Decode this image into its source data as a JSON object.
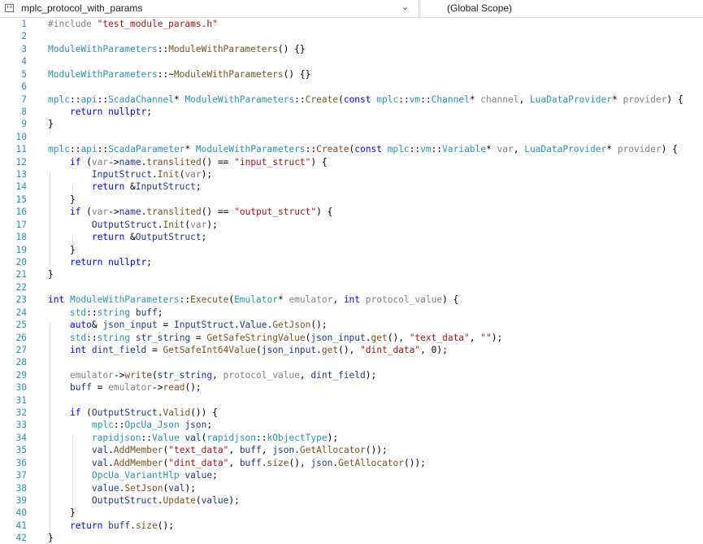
{
  "nav": {
    "project_name": "mplc_protocol_with_params",
    "scope_name": "(Global Scope)"
  },
  "editor": {
    "lines": [
      {
        "n": "1",
        "t": [
          [
            "pp",
            "#include "
          ],
          [
            "st",
            "\"test_module_params.h\""
          ]
        ]
      },
      {
        "n": "2",
        "t": []
      },
      {
        "n": "3",
        "t": [
          [
            "ty",
            "ModuleWithParameters"
          ],
          [
            "pu",
            "::"
          ],
          [
            "fn",
            "ModuleWithParameters"
          ],
          [
            "pu",
            "() {}"
          ]
        ]
      },
      {
        "n": "4",
        "t": []
      },
      {
        "n": "5",
        "t": [
          [
            "ty",
            "ModuleWithParameters"
          ],
          [
            "pu",
            "::~"
          ],
          [
            "fn",
            "ModuleWithParameters"
          ],
          [
            "pu",
            "() {}"
          ]
        ]
      },
      {
        "n": "6",
        "t": []
      },
      {
        "n": "7",
        "t": [
          [
            "ns",
            "mplc"
          ],
          [
            "pu",
            "::"
          ],
          [
            "ns",
            "api"
          ],
          [
            "pu",
            "::"
          ],
          [
            "ty",
            "ScadaChannel"
          ],
          [
            "pu",
            "* "
          ],
          [
            "ty",
            "ModuleWithParameters"
          ],
          [
            "pu",
            "::"
          ],
          [
            "fn",
            "Create"
          ],
          [
            "pu",
            "("
          ],
          [
            "kw",
            "const "
          ],
          [
            "ns",
            "mplc"
          ],
          [
            "pu",
            "::"
          ],
          [
            "ns",
            "vm"
          ],
          [
            "pu",
            "::"
          ],
          [
            "ty",
            "Channel"
          ],
          [
            "pu",
            "* "
          ],
          [
            "pm",
            "channel"
          ],
          [
            "pu",
            ", "
          ],
          [
            "ty",
            "LuaDataProvider"
          ],
          [
            "pu",
            "* "
          ],
          [
            "pm",
            "provider"
          ],
          [
            "pu",
            ") {"
          ]
        ]
      },
      {
        "n": "8",
        "t": [
          [
            "pu",
            "    "
          ],
          [
            "kw",
            "return "
          ],
          [
            "kw",
            "nullptr"
          ],
          [
            "pu",
            ";"
          ]
        ]
      },
      {
        "n": "9",
        "t": [
          [
            "pu",
            "}"
          ]
        ]
      },
      {
        "n": "10",
        "t": []
      },
      {
        "n": "11",
        "t": [
          [
            "ns",
            "mplc"
          ],
          [
            "pu",
            "::"
          ],
          [
            "ns",
            "api"
          ],
          [
            "pu",
            "::"
          ],
          [
            "ty",
            "ScadaParameter"
          ],
          [
            "pu",
            "* "
          ],
          [
            "ty",
            "ModuleWithParameters"
          ],
          [
            "pu",
            "::"
          ],
          [
            "fn",
            "Create"
          ],
          [
            "pu",
            "("
          ],
          [
            "kw",
            "const "
          ],
          [
            "ns",
            "mplc"
          ],
          [
            "pu",
            "::"
          ],
          [
            "ns",
            "vm"
          ],
          [
            "pu",
            "::"
          ],
          [
            "ty",
            "Variable"
          ],
          [
            "pu",
            "* "
          ],
          [
            "pm",
            "var"
          ],
          [
            "pu",
            ", "
          ],
          [
            "ty",
            "LuaDataProvider"
          ],
          [
            "pu",
            "* "
          ],
          [
            "pm",
            "provider"
          ],
          [
            "pu",
            ") {"
          ]
        ]
      },
      {
        "n": "12",
        "t": [
          [
            "pu",
            "    "
          ],
          [
            "kw",
            "if "
          ],
          [
            "pu",
            "("
          ],
          [
            "pm",
            "var"
          ],
          [
            "pu",
            "->"
          ],
          [
            "mv",
            "name"
          ],
          [
            "pu",
            "."
          ],
          [
            "fn",
            "translited"
          ],
          [
            "pu",
            "() == "
          ],
          [
            "st",
            "\"input_struct\""
          ],
          [
            "pu",
            ") {"
          ]
        ]
      },
      {
        "n": "13",
        "t": [
          [
            "pu",
            "        "
          ],
          [
            "ve",
            "InputStruct"
          ],
          [
            "pu",
            "."
          ],
          [
            "fn",
            "Init"
          ],
          [
            "pu",
            "("
          ],
          [
            "pm",
            "var"
          ],
          [
            "pu",
            ");"
          ]
        ]
      },
      {
        "n": "14",
        "t": [
          [
            "pu",
            "        "
          ],
          [
            "kw",
            "return "
          ],
          [
            "pu",
            "&"
          ],
          [
            "ve",
            "InputStruct"
          ],
          [
            "pu",
            ";"
          ]
        ]
      },
      {
        "n": "15",
        "t": [
          [
            "pu",
            "    }"
          ]
        ]
      },
      {
        "n": "16",
        "t": [
          [
            "pu",
            "    "
          ],
          [
            "kw",
            "if "
          ],
          [
            "pu",
            "("
          ],
          [
            "pm",
            "var"
          ],
          [
            "pu",
            "->"
          ],
          [
            "mv",
            "name"
          ],
          [
            "pu",
            "."
          ],
          [
            "fn",
            "translited"
          ],
          [
            "pu",
            "() == "
          ],
          [
            "st",
            "\"output_struct\""
          ],
          [
            "pu",
            ") {"
          ]
        ]
      },
      {
        "n": "17",
        "t": [
          [
            "pu",
            "        "
          ],
          [
            "ve",
            "OutputStruct"
          ],
          [
            "pu",
            "."
          ],
          [
            "fn",
            "Init"
          ],
          [
            "pu",
            "("
          ],
          [
            "pm",
            "var"
          ],
          [
            "pu",
            ");"
          ]
        ]
      },
      {
        "n": "18",
        "t": [
          [
            "pu",
            "        "
          ],
          [
            "kw",
            "return "
          ],
          [
            "pu",
            "&"
          ],
          [
            "ve",
            "OutputStruct"
          ],
          [
            "pu",
            ";"
          ]
        ]
      },
      {
        "n": "19",
        "t": [
          [
            "pu",
            "    }"
          ]
        ]
      },
      {
        "n": "20",
        "t": [
          [
            "pu",
            "    "
          ],
          [
            "kw",
            "return "
          ],
          [
            "kw",
            "nullptr"
          ],
          [
            "pu",
            ";"
          ]
        ]
      },
      {
        "n": "21",
        "t": [
          [
            "pu",
            "}"
          ]
        ]
      },
      {
        "n": "22",
        "t": []
      },
      {
        "n": "23",
        "t": [
          [
            "kw",
            "int "
          ],
          [
            "ty",
            "ModuleWithParameters"
          ],
          [
            "pu",
            "::"
          ],
          [
            "fn",
            "Execute"
          ],
          [
            "pu",
            "("
          ],
          [
            "ty",
            "Emulator"
          ],
          [
            "pu",
            "* "
          ],
          [
            "pm",
            "emulator"
          ],
          [
            "pu",
            ", "
          ],
          [
            "kw",
            "int "
          ],
          [
            "pm",
            "protocol_value"
          ],
          [
            "pu",
            ") {"
          ]
        ]
      },
      {
        "n": "24",
        "t": [
          [
            "pu",
            "    "
          ],
          [
            "ns",
            "std"
          ],
          [
            "pu",
            "::"
          ],
          [
            "ty",
            "string"
          ],
          [
            "pu",
            " "
          ],
          [
            "lv",
            "buff"
          ],
          [
            "pu",
            ";"
          ]
        ]
      },
      {
        "n": "25",
        "t": [
          [
            "pu",
            "    "
          ],
          [
            "kw",
            "auto"
          ],
          [
            "pu",
            "& "
          ],
          [
            "lv",
            "json_input"
          ],
          [
            "pu",
            " = "
          ],
          [
            "ve",
            "InputStruct"
          ],
          [
            "pu",
            "."
          ],
          [
            "mv",
            "Value"
          ],
          [
            "pu",
            "."
          ],
          [
            "fn",
            "GetJson"
          ],
          [
            "pu",
            "();"
          ]
        ]
      },
      {
        "n": "26",
        "t": [
          [
            "pu",
            "    "
          ],
          [
            "ns",
            "std"
          ],
          [
            "pu",
            "::"
          ],
          [
            "ty",
            "string"
          ],
          [
            "pu",
            " "
          ],
          [
            "lv",
            "str_string"
          ],
          [
            "pu",
            " = "
          ],
          [
            "fn",
            "GetSafeStringValue"
          ],
          [
            "pu",
            "("
          ],
          [
            "lv",
            "json_input"
          ],
          [
            "pu",
            "."
          ],
          [
            "fn",
            "get"
          ],
          [
            "pu",
            "(), "
          ],
          [
            "st",
            "\"text_data\""
          ],
          [
            "pu",
            ", "
          ],
          [
            "st",
            "\"\""
          ],
          [
            "pu",
            ");"
          ]
        ]
      },
      {
        "n": "27",
        "t": [
          [
            "pu",
            "    "
          ],
          [
            "kw",
            "int "
          ],
          [
            "lv",
            "dint_field"
          ],
          [
            "pu",
            " = "
          ],
          [
            "fn",
            "GetSafeInt64Value"
          ],
          [
            "pu",
            "("
          ],
          [
            "lv",
            "json_input"
          ],
          [
            "pu",
            "."
          ],
          [
            "fn",
            "get"
          ],
          [
            "pu",
            "(), "
          ],
          [
            "st",
            "\"dint_data\""
          ],
          [
            "pu",
            ", 0);"
          ]
        ]
      },
      {
        "n": "28",
        "t": []
      },
      {
        "n": "29",
        "t": [
          [
            "pu",
            "    "
          ],
          [
            "pm",
            "emulator"
          ],
          [
            "pu",
            "->"
          ],
          [
            "fn",
            "write"
          ],
          [
            "pu",
            "("
          ],
          [
            "lv",
            "str_string"
          ],
          [
            "pu",
            ", "
          ],
          [
            "pm",
            "protocol_value"
          ],
          [
            "pu",
            ", "
          ],
          [
            "lv",
            "dint_field"
          ],
          [
            "pu",
            ");"
          ]
        ]
      },
      {
        "n": "30",
        "t": [
          [
            "pu",
            "    "
          ],
          [
            "lv",
            "buff"
          ],
          [
            "pu",
            " = "
          ],
          [
            "pm",
            "emulator"
          ],
          [
            "pu",
            "->"
          ],
          [
            "fn",
            "read"
          ],
          [
            "pu",
            "();"
          ]
        ]
      },
      {
        "n": "31",
        "t": []
      },
      {
        "n": "32",
        "t": [
          [
            "pu",
            "    "
          ],
          [
            "kw",
            "if "
          ],
          [
            "pu",
            "("
          ],
          [
            "ve",
            "OutputStruct"
          ],
          [
            "pu",
            "."
          ],
          [
            "fn",
            "Valid"
          ],
          [
            "pu",
            "()) {"
          ]
        ]
      },
      {
        "n": "33",
        "t": [
          [
            "pu",
            "        "
          ],
          [
            "ns",
            "mplc"
          ],
          [
            "pu",
            "::"
          ],
          [
            "ty",
            "OpcUa_Json"
          ],
          [
            "pu",
            " "
          ],
          [
            "lv",
            "json"
          ],
          [
            "pu",
            ";"
          ]
        ]
      },
      {
        "n": "34",
        "t": [
          [
            "pu",
            "        "
          ],
          [
            "ns",
            "rapidjson"
          ],
          [
            "pu",
            "::"
          ],
          [
            "ty",
            "Value"
          ],
          [
            "pu",
            " "
          ],
          [
            "lv",
            "val"
          ],
          [
            "pu",
            "("
          ],
          [
            "ns",
            "rapidjson"
          ],
          [
            "pu",
            "::"
          ],
          [
            "ty",
            "kObjectType"
          ],
          [
            "pu",
            ");"
          ]
        ]
      },
      {
        "n": "35",
        "t": [
          [
            "pu",
            "        "
          ],
          [
            "lv",
            "val"
          ],
          [
            "pu",
            "."
          ],
          [
            "fn",
            "AddMember"
          ],
          [
            "pu",
            "("
          ],
          [
            "st",
            "\"text_data\""
          ],
          [
            "pu",
            ", "
          ],
          [
            "lv",
            "buff"
          ],
          [
            "pu",
            ", "
          ],
          [
            "lv",
            "json"
          ],
          [
            "pu",
            "."
          ],
          [
            "fn",
            "GetAllocator"
          ],
          [
            "pu",
            "());"
          ]
        ]
      },
      {
        "n": "36",
        "t": [
          [
            "pu",
            "        "
          ],
          [
            "lv",
            "val"
          ],
          [
            "pu",
            "."
          ],
          [
            "fn",
            "AddMember"
          ],
          [
            "pu",
            "("
          ],
          [
            "st",
            "\"dint_data\""
          ],
          [
            "pu",
            ", "
          ],
          [
            "lv",
            "buff"
          ],
          [
            "pu",
            "."
          ],
          [
            "fn",
            "size"
          ],
          [
            "pu",
            "(), "
          ],
          [
            "lv",
            "json"
          ],
          [
            "pu",
            "."
          ],
          [
            "fn",
            "GetAllocator"
          ],
          [
            "pu",
            "());"
          ]
        ]
      },
      {
        "n": "37",
        "t": [
          [
            "pu",
            "        "
          ],
          [
            "ty",
            "OpcUa_VariantHlp"
          ],
          [
            "pu",
            " "
          ],
          [
            "lv",
            "value"
          ],
          [
            "pu",
            ";"
          ]
        ]
      },
      {
        "n": "38",
        "t": [
          [
            "pu",
            "        "
          ],
          [
            "lv",
            "value"
          ],
          [
            "pu",
            "."
          ],
          [
            "fn",
            "SetJson"
          ],
          [
            "pu",
            "("
          ],
          [
            "lv",
            "val"
          ],
          [
            "pu",
            ");"
          ]
        ]
      },
      {
        "n": "39",
        "t": [
          [
            "pu",
            "        "
          ],
          [
            "ve",
            "OutputStruct"
          ],
          [
            "pu",
            "."
          ],
          [
            "fn",
            "Update"
          ],
          [
            "pu",
            "("
          ],
          [
            "lv",
            "value"
          ],
          [
            "pu",
            ");"
          ]
        ]
      },
      {
        "n": "40",
        "t": [
          [
            "pu",
            "    }"
          ]
        ]
      },
      {
        "n": "41",
        "t": [
          [
            "pu",
            "    "
          ],
          [
            "kw",
            "return "
          ],
          [
            "lv",
            "buff"
          ],
          [
            "pu",
            "."
          ],
          [
            "fn",
            "size"
          ],
          [
            "pu",
            "();"
          ]
        ]
      },
      {
        "n": "42",
        "t": [
          [
            "pu",
            "}"
          ]
        ]
      }
    ]
  }
}
